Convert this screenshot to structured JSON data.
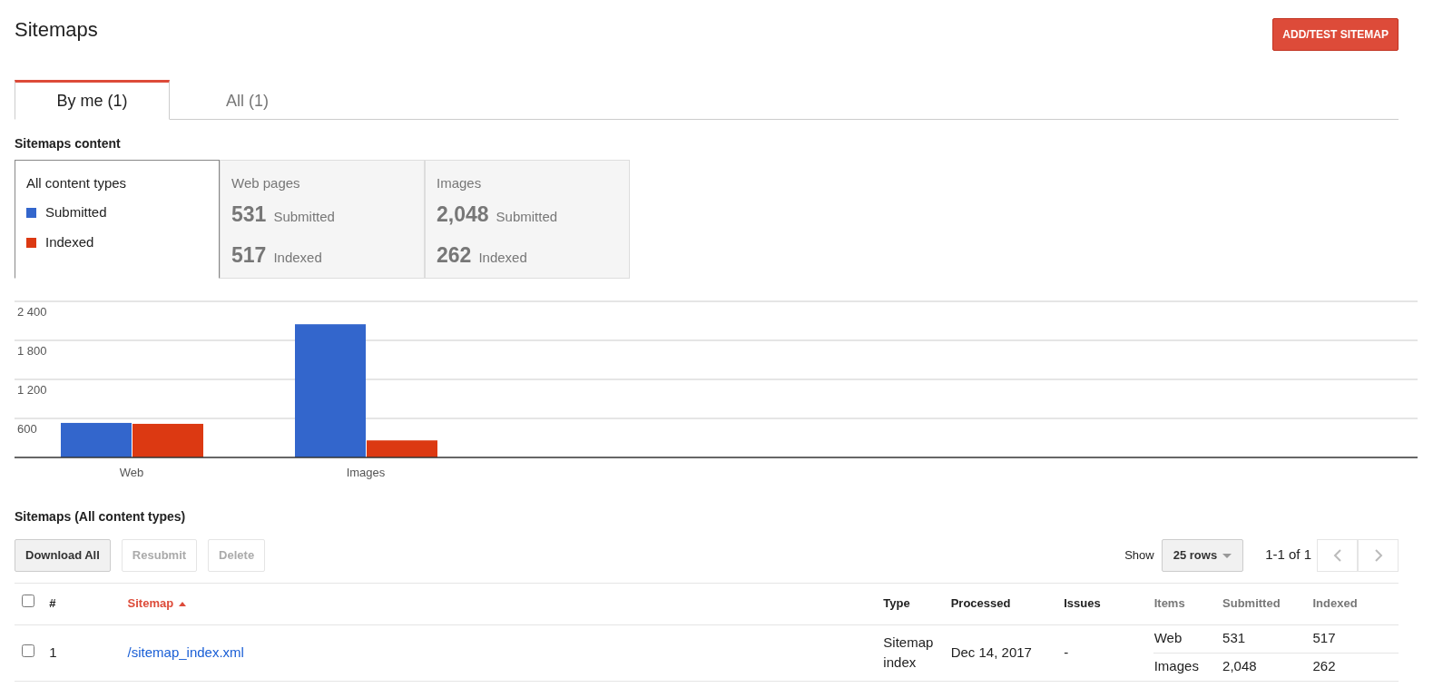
{
  "page": {
    "title": "Sitemaps",
    "add_button": "ADD/TEST SITEMAP"
  },
  "tabs": [
    {
      "label": "By me (1)",
      "selected": true
    },
    {
      "label": "All (1)",
      "selected": false
    }
  ],
  "content_heading": "Sitemaps content",
  "content_types": [
    {
      "kind": "legend",
      "title": "All content types",
      "selected": true
    },
    {
      "kind": "stats",
      "title": "Web pages",
      "selected": false,
      "stats": [
        {
          "value": "531",
          "label": "Submitted"
        },
        {
          "value": "517",
          "label": "Indexed"
        }
      ]
    },
    {
      "kind": "stats",
      "title": "Images",
      "selected": false,
      "stats": [
        {
          "value": "2,048",
          "label": "Submitted"
        },
        {
          "value": "262",
          "label": "Indexed"
        }
      ]
    }
  ],
  "chart_data": {
    "type": "bar",
    "categories": [
      "Web",
      "Images"
    ],
    "series": [
      {
        "name": "Submitted",
        "color": "#3366cc",
        "values": [
          531,
          2048
        ]
      },
      {
        "name": "Indexed",
        "color": "#dc3912",
        "values": [
          517,
          262
        ]
      }
    ],
    "grid": true,
    "ylim": [
      0,
      2400
    ],
    "yticks": [
      600,
      {
        "value": 1200,
        "label": "1 200"
      },
      {
        "value": 1800,
        "label": "1 800"
      },
      {
        "value": 2400,
        "label": "2 400"
      }
    ]
  },
  "sitemaps_heading": "Sitemaps (All content types)",
  "actions": [
    {
      "label": "Download All",
      "disabled": false
    },
    {
      "label": "Resubmit",
      "disabled": true
    },
    {
      "label": "Delete",
      "disabled": true
    }
  ],
  "pager": {
    "show_label": "Show",
    "rows": "25 rows",
    "range": "1-1 of 1"
  },
  "table": {
    "header_checked": false,
    "columns": [
      {
        "label": "#",
        "sorted": false,
        "muted": false
      },
      {
        "label": "Sitemap",
        "sorted": true,
        "muted": false
      },
      {
        "label": "Type",
        "sorted": false,
        "muted": false
      },
      {
        "label": "Processed",
        "sorted": false,
        "muted": false
      },
      {
        "label": "Issues",
        "sorted": false,
        "muted": false
      },
      {
        "label": "Items",
        "sorted": false,
        "muted": true
      },
      {
        "label": "Submitted",
        "sorted": false,
        "muted": true
      },
      {
        "label": "Indexed",
        "sorted": false,
        "muted": true
      }
    ],
    "rows": [
      {
        "checked": false,
        "number": "1",
        "sitemap": "/sitemap_index.xml",
        "type": "Sitemap index",
        "processed": "Dec 14, 2017",
        "issues": "-",
        "items": [
          {
            "item": "Web",
            "submitted": "531",
            "indexed": "517"
          },
          {
            "item": "Images",
            "submitted": "2,048",
            "indexed": "262"
          }
        ]
      }
    ]
  }
}
